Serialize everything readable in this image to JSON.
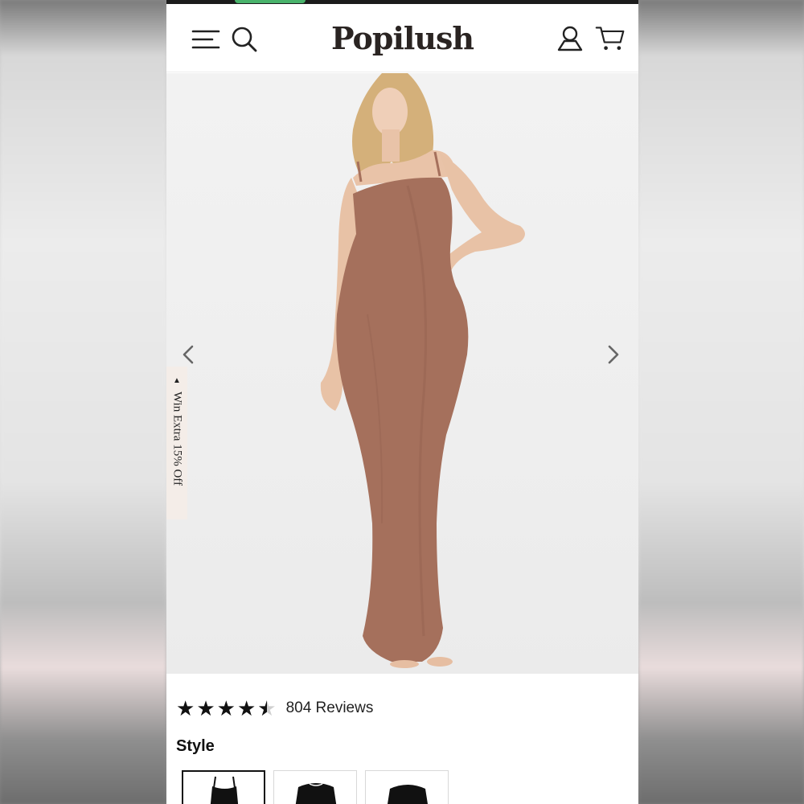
{
  "header": {
    "brand": "Popilush",
    "icons": [
      "menu-icon",
      "search-icon",
      "account-icon",
      "cart-icon"
    ]
  },
  "hero": {
    "image_alt": "Model wearing brown ribbed maxi slip dress",
    "dress_color": "#a5705c",
    "promo_tab": "Win Extra 15% Off"
  },
  "rating": {
    "stars": 4.5,
    "reviews_label": "804 Reviews"
  },
  "style": {
    "label": "Style",
    "options": [
      "Spaghetti strap",
      "Long sleeve",
      "Long sleeve"
    ]
  }
}
